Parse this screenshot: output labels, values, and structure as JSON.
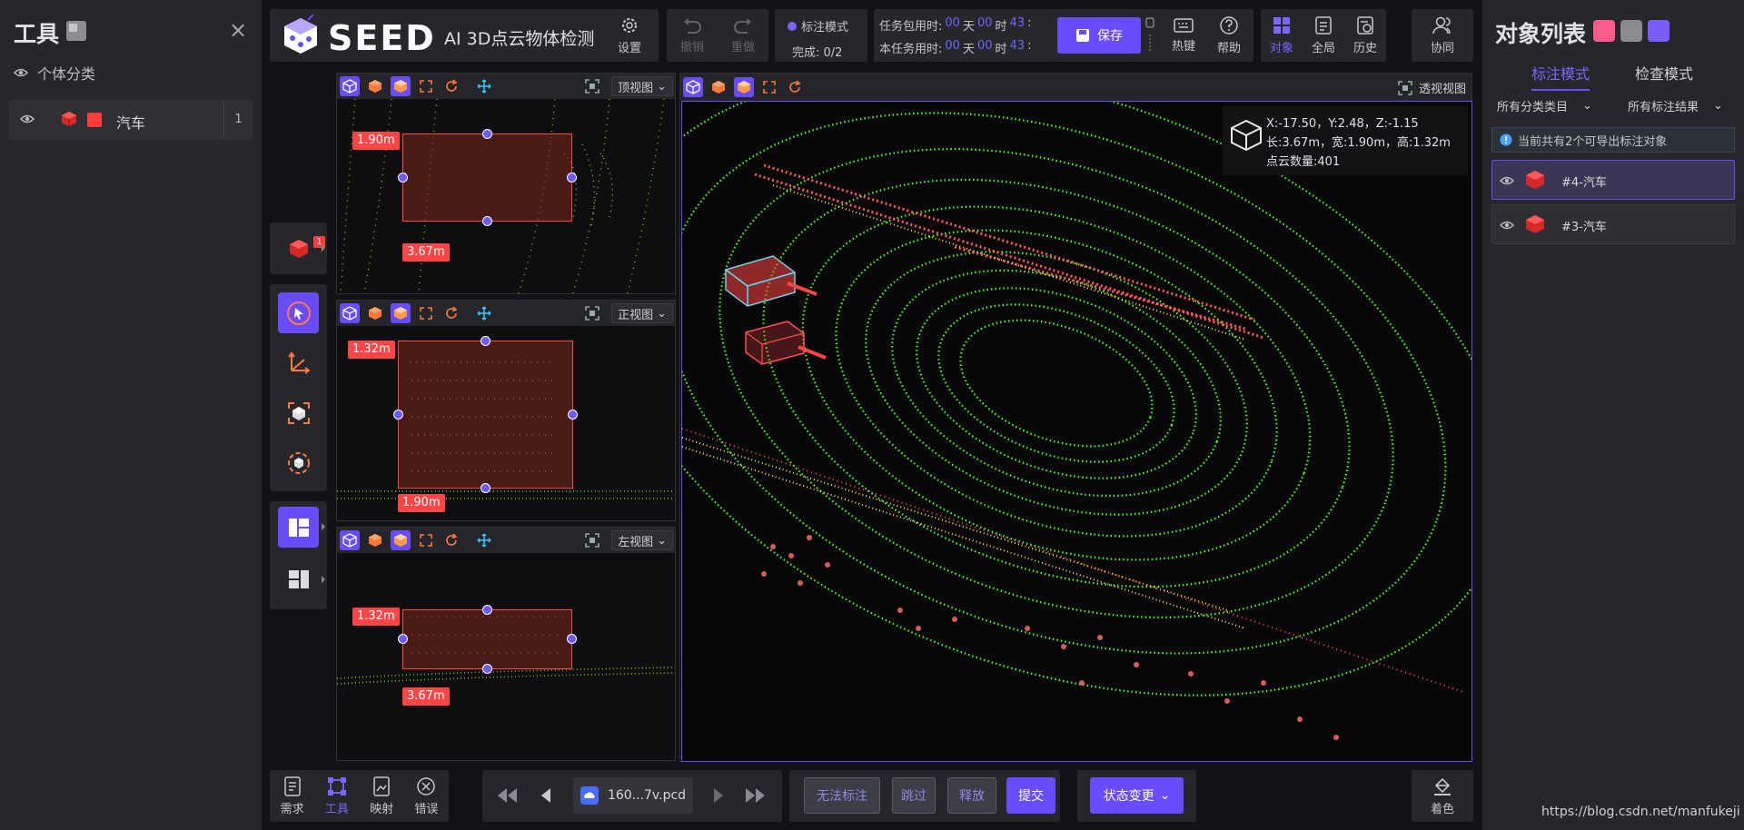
{
  "left": {
    "title": "工具",
    "category_label": "个体分类",
    "object": {
      "name": "汽车",
      "count": "1"
    }
  },
  "header": {
    "brand": "SEED",
    "app_name": "AI 3D点云物体检测",
    "settings": "设置",
    "undo": "撤销",
    "redo": "重做",
    "mode": "标注模式",
    "complete": "完成: 0/2",
    "pkg_time_label": "任务包用时:",
    "task_time_label": "本任务用时:",
    "pkg_time": {
      "d": "00",
      "du": "天",
      "h": "00",
      "hu": "时",
      "m": "43",
      "mu": ":"
    },
    "task_time": {
      "d": "00",
      "du": "天",
      "h": "00",
      "hu": "时",
      "m": "43",
      "mu": ":"
    },
    "save": "保存",
    "hotkey": "热键",
    "help": "帮助",
    "tabs": [
      "对象",
      "全局",
      "历史"
    ],
    "collab": "协同"
  },
  "tools": {
    "badge": "1"
  },
  "views": {
    "top": {
      "name": "顶视图",
      "w": "1.90m",
      "l": "3.67m"
    },
    "front": {
      "name": "正视图",
      "h": "1.32m",
      "w": "1.90m"
    },
    "side": {
      "name": "左视图",
      "h": "1.32m",
      "l": "3.67m"
    },
    "persp": {
      "name": "透视视图"
    }
  },
  "info": {
    "line1": "X:-17.50，Y:2.48，Z:-1.15",
    "line2": "长:3.67m，宽:1.90m，高:1.32m",
    "line3": "点云数量:401"
  },
  "right": {
    "title": "对象列表",
    "tab_active": "标注模式",
    "tab_other": "检查模式",
    "filter1": "所有分类类目",
    "filter2": "所有标注结果",
    "notice": "当前共有2个可导出标注对象",
    "objects": [
      "#4-汽车",
      "#3-汽车"
    ]
  },
  "bottom": {
    "items": [
      "需求",
      "工具",
      "映射",
      "错误"
    ],
    "file": "160...7v.pcd",
    "no_label": "无法标注",
    "skip": "跳过",
    "release": "释放",
    "submit": "提交",
    "status": "状态变更",
    "color": "着色"
  },
  "watermark": "https://blog.csdn.net/manfukeji",
  "colors": {
    "accent": "#6a4cff",
    "box": "#ff4545",
    "points_near": "#44ff22",
    "points_far": "#ff5a5a"
  }
}
